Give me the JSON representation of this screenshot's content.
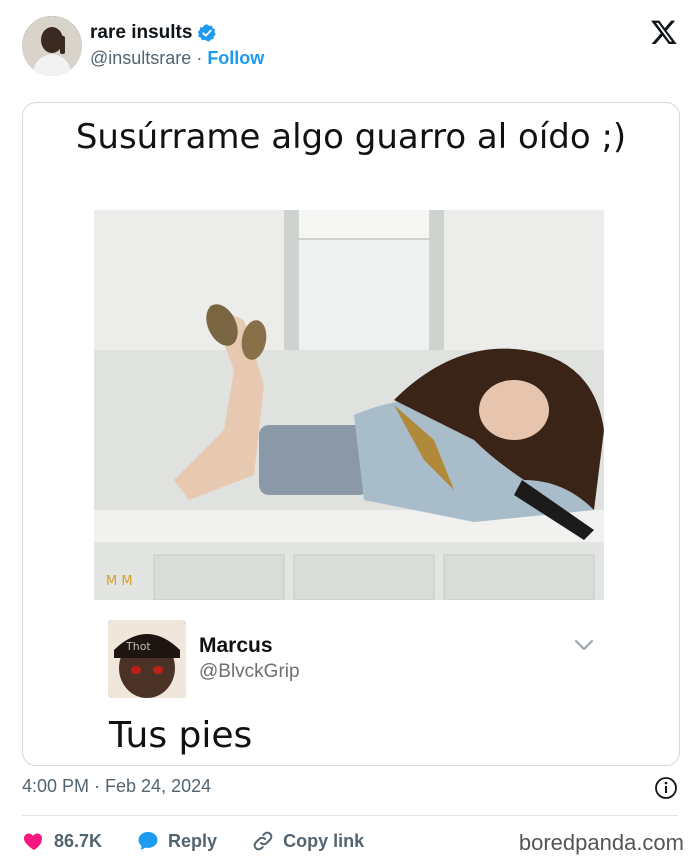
{
  "header": {
    "display_name": "rare insults",
    "handle": "@insultsrare",
    "separator": "·",
    "follow_label": "Follow",
    "icons": {
      "verified": "verified-badge-icon",
      "brand": "x-logo-icon"
    },
    "colors": {
      "accent": "#1d9bf0",
      "muted": "#536471"
    }
  },
  "meme": {
    "title": "Susúrrame algo guarro al oído ;)",
    "reply": {
      "name": "Marcus",
      "handle": "@BlvckGrip",
      "text": "Tus pies"
    }
  },
  "tweet": {
    "timestamp": "4:00 PM · Feb 24, 2024"
  },
  "actions": {
    "likes_count": "86.7K",
    "reply_label": "Reply",
    "copy_label": "Copy link",
    "colors": {
      "like": "#f91880",
      "reply": "#1d9bf0"
    }
  },
  "watermark": "boredpanda.com"
}
